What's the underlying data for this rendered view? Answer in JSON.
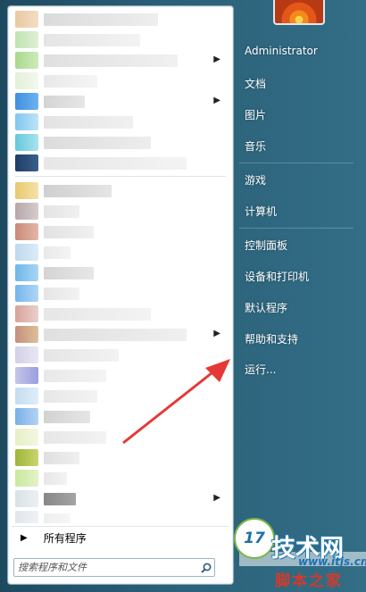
{
  "right_column": {
    "user_name": "Administrator",
    "documents": "文档",
    "pictures": "图片",
    "music": "音乐",
    "games": "游戏",
    "computer": "计算机",
    "control_panel": "控制面板",
    "devices_printers": "设备和打印机",
    "default_programs": "默认程序",
    "help_support": "帮助和支持",
    "run": "运行..."
  },
  "left_panel": {
    "all_programs": "所有程序",
    "search_placeholder": "搜索程序和文件"
  },
  "watermark": {
    "badge": "17",
    "title": "技术网",
    "url": "www.itjs.cn",
    "bottom": "脚本之家"
  },
  "colors": {
    "annotation_arrow": "#e53935",
    "left_panel_bg": "#ffffff",
    "desktop_bg": "#2a6078"
  }
}
